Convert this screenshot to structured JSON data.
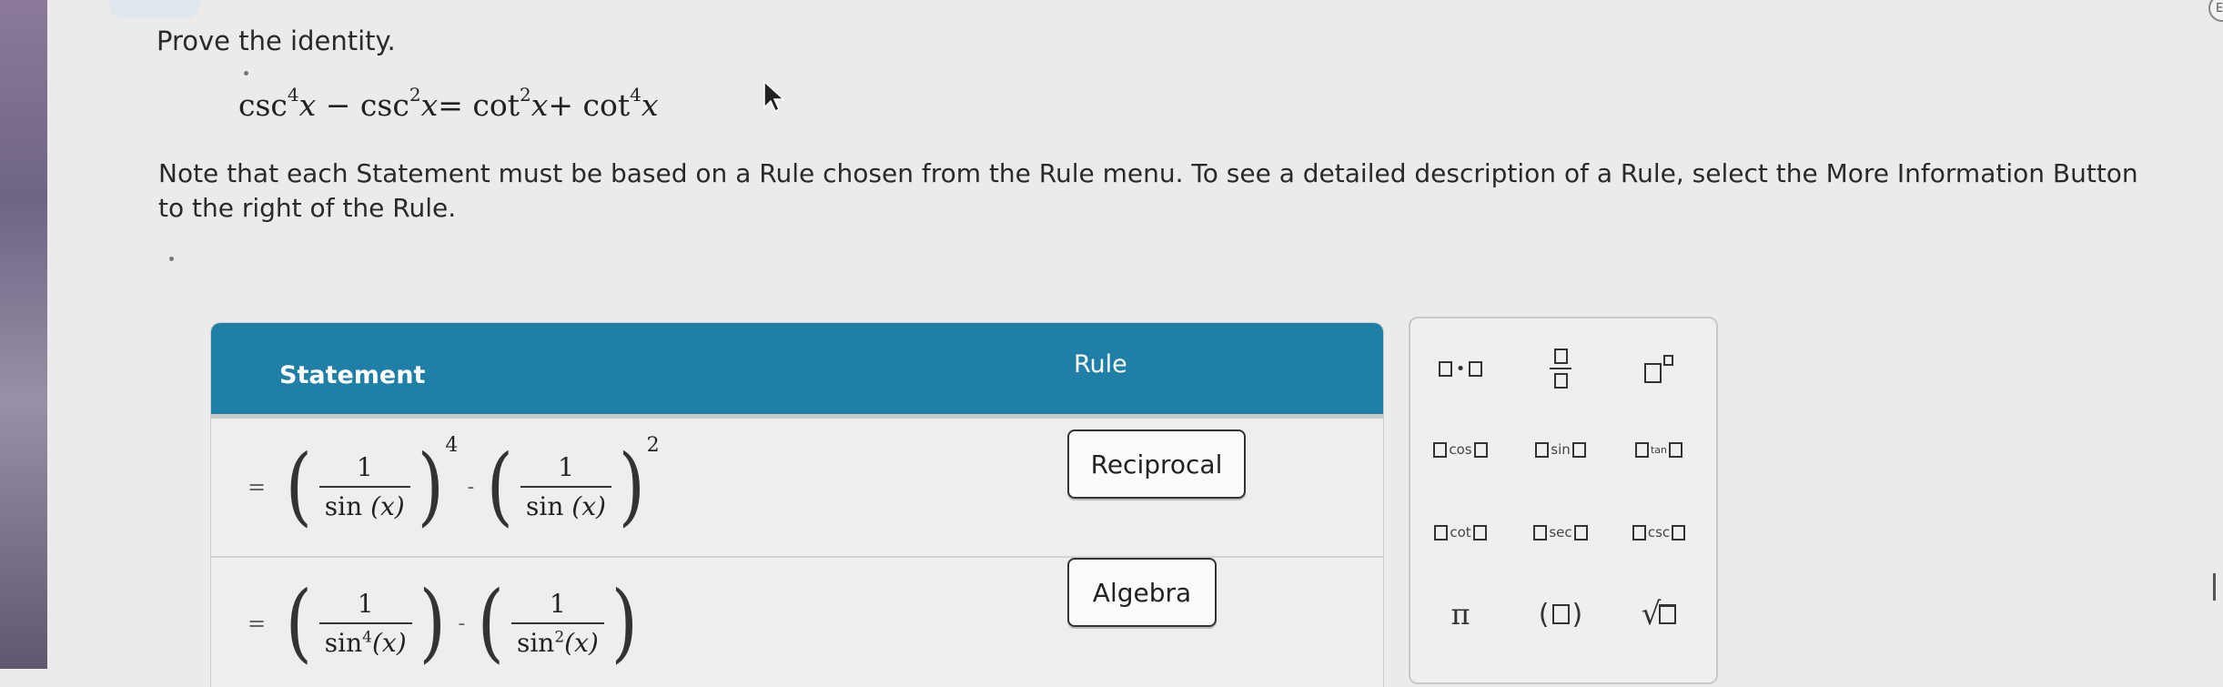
{
  "prompt": {
    "heading": "Prove the identity.",
    "note": "Note that each Statement must be based on a Rule chosen from the Rule menu. To see a detailed description of a Rule, select the More Information Button to the right of the Rule."
  },
  "identity": {
    "t1": "csc",
    "e1": "4",
    "v1": "x",
    "op1": "−",
    "t2": "csc",
    "e2": "2",
    "v2": "x",
    "op2": "=",
    "t3": "cot",
    "e3": "2",
    "v3": "x",
    "op3": "+",
    "t4": "cot",
    "e4": "4",
    "v4": "x"
  },
  "proof": {
    "headers": {
      "statement": "Statement",
      "rule": "Rule"
    },
    "rows": [
      {
        "eq": "=",
        "a_num": "1",
        "a_fn": "sin",
        "a_var": "(x)",
        "a_pow": "4",
        "minus": "-",
        "b_num": "1",
        "b_fn": "sin",
        "b_var": "(x)",
        "b_pow": "2",
        "rule": "Reciprocal"
      },
      {
        "eq": "=",
        "a_num": "1",
        "a_fn": "sin",
        "a_sup": "4",
        "a_var": "(x)",
        "minus": "-",
        "b_num": "1",
        "b_fn": "sin",
        "b_sup": "2",
        "b_var": "(x)",
        "rule": "Algebra"
      }
    ]
  },
  "palette": {
    "multiply": "•",
    "cos": "cos",
    "sin": "sin",
    "tan": "tan",
    "cot": "cot",
    "sec": "sec",
    "csc": "csc",
    "pi": "π",
    "paren_open": "(",
    "paren_close": ")",
    "sqrt": "√"
  },
  "edge_badge": "E",
  "colors": {
    "header": "#1f7fa6",
    "background": "#eceaea"
  }
}
